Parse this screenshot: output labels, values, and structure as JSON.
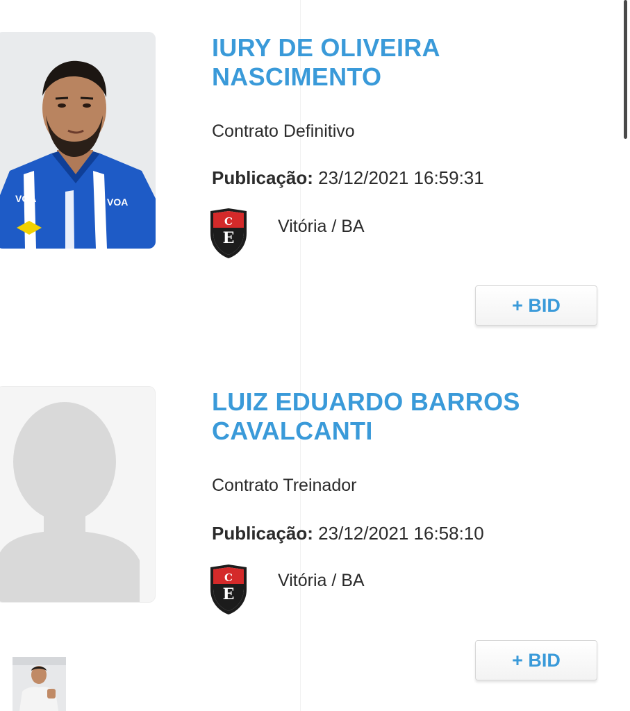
{
  "listing": {
    "entries": [
      {
        "name_line1": "IURY DE OLIVEIRA",
        "name_line2": "NASCIMENTO",
        "contract": "Contrato Definitivo",
        "publication_label": "Publicação:",
        "publication_value": "23/12/2021 16:59:31",
        "club": "Vitória / BA",
        "bid_label": "+ BID",
        "photo": "player-photo"
      },
      {
        "name_line1": "LUIZ EDUARDO BARROS",
        "name_line2": "CAVALCANTI",
        "contract": "Contrato Treinador",
        "publication_label": "Publicação:",
        "publication_value": "23/12/2021 16:58:10",
        "club": "Vitória / BA",
        "bid_label": "+ BID",
        "photo": "placeholder-avatar"
      }
    ]
  },
  "colors": {
    "name": "#3a9ad9",
    "text": "#2b2b2b",
    "crest_red": "#d42a2a",
    "crest_black": "#1c1c1c",
    "jersey_blue": "#1e5bc6"
  },
  "icons": [
    "club-crest-icon",
    "plus-icon",
    "avatar-silhouette"
  ]
}
